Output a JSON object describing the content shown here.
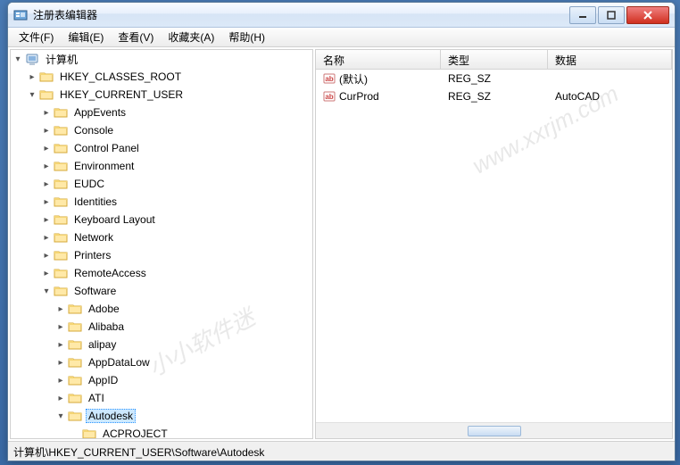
{
  "window": {
    "title": "注册表编辑器"
  },
  "menu": {
    "file": "文件(F)",
    "edit": "编辑(E)",
    "view": "查看(V)",
    "fav": "收藏夹(A)",
    "help": "帮助(H)"
  },
  "tree": {
    "root": "计算机",
    "hkcr": "HKEY_CLASSES_ROOT",
    "hkcu": "HKEY_CURRENT_USER",
    "nodes": [
      "AppEvents",
      "Console",
      "Control Panel",
      "Environment",
      "EUDC",
      "Identities",
      "Keyboard Layout",
      "Network",
      "Printers",
      "RemoteAccess"
    ],
    "software": "Software",
    "software_children": [
      "Adobe",
      "Alibaba",
      "alipay",
      "AppDataLow",
      "AppID",
      "ATI"
    ],
    "autodesk": "Autodesk",
    "acproject": "ACPROJECT"
  },
  "list": {
    "headers": {
      "name": "名称",
      "type": "类型",
      "data": "数据"
    },
    "rows": [
      {
        "name": "(默认)",
        "type": "REG_SZ",
        "data": ""
      },
      {
        "name": "CurProd",
        "type": "REG_SZ",
        "data": "AutoCAD"
      }
    ]
  },
  "status": "计算机\\HKEY_CURRENT_USER\\Software\\Autodesk",
  "watermark1": "www.xxrjm.com",
  "watermark2": "小小软件迷"
}
